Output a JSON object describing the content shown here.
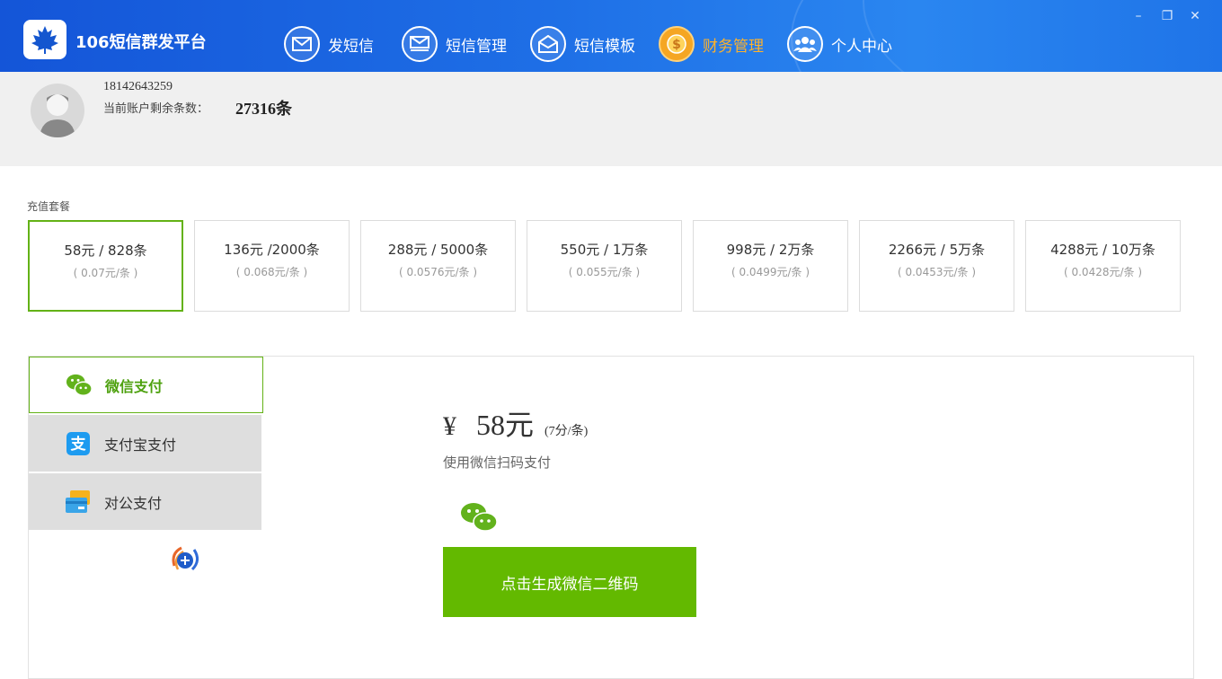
{
  "app": {
    "title": "106短信群发平台"
  },
  "nav": [
    {
      "label": "发短信",
      "icon": "envelope-icon"
    },
    {
      "label": "短信管理",
      "icon": "inbox-icon"
    },
    {
      "label": "短信模板",
      "icon": "open-envelope-icon"
    },
    {
      "label": "财务管理",
      "icon": "coin-icon",
      "active": true
    },
    {
      "label": "个人中心",
      "icon": "users-icon"
    }
  ],
  "window_controls": {
    "minimize": "–",
    "restore": "❐",
    "close": "✕"
  },
  "account": {
    "phone": "18142643259",
    "remain_label": "当前账户剩余条数：",
    "remain_value": "27316条"
  },
  "packages": {
    "label": "充值套餐",
    "items": [
      {
        "title": "58元 / 828条",
        "unit": "( 0.07元/条 )",
        "selected": true
      },
      {
        "title": "136元 /2000条",
        "unit": "( 0.068元/条 )"
      },
      {
        "title": "288元 / 5000条",
        "unit": "( 0.0576元/条 )"
      },
      {
        "title": "550元 / 1万条",
        "unit": "( 0.055元/条 )"
      },
      {
        "title": "998元 / 2万条",
        "unit": "( 0.0499元/条 )"
      },
      {
        "title": "2266元 / 5万条",
        "unit": "( 0.0453元/条 )"
      },
      {
        "title": "4288元 / 10万条",
        "unit": "( 0.0428元/条 )"
      }
    ]
  },
  "payment": {
    "tabs": [
      {
        "label": "微信支付",
        "icon": "wechat-icon",
        "active": true
      },
      {
        "label": "支付宝支付",
        "icon": "alipay-icon"
      },
      {
        "label": "对公支付",
        "icon": "bank-card-icon"
      }
    ],
    "yen": "¥",
    "amount": "58元",
    "per_unit": "(7分/条)",
    "hint": "使用微信扫码支付",
    "generate_button": "点击生成微信二维码"
  },
  "colors": {
    "header_blue": "#1e6fe6",
    "accent_green": "#63b900",
    "active_nav_orange": "#f5a623"
  }
}
